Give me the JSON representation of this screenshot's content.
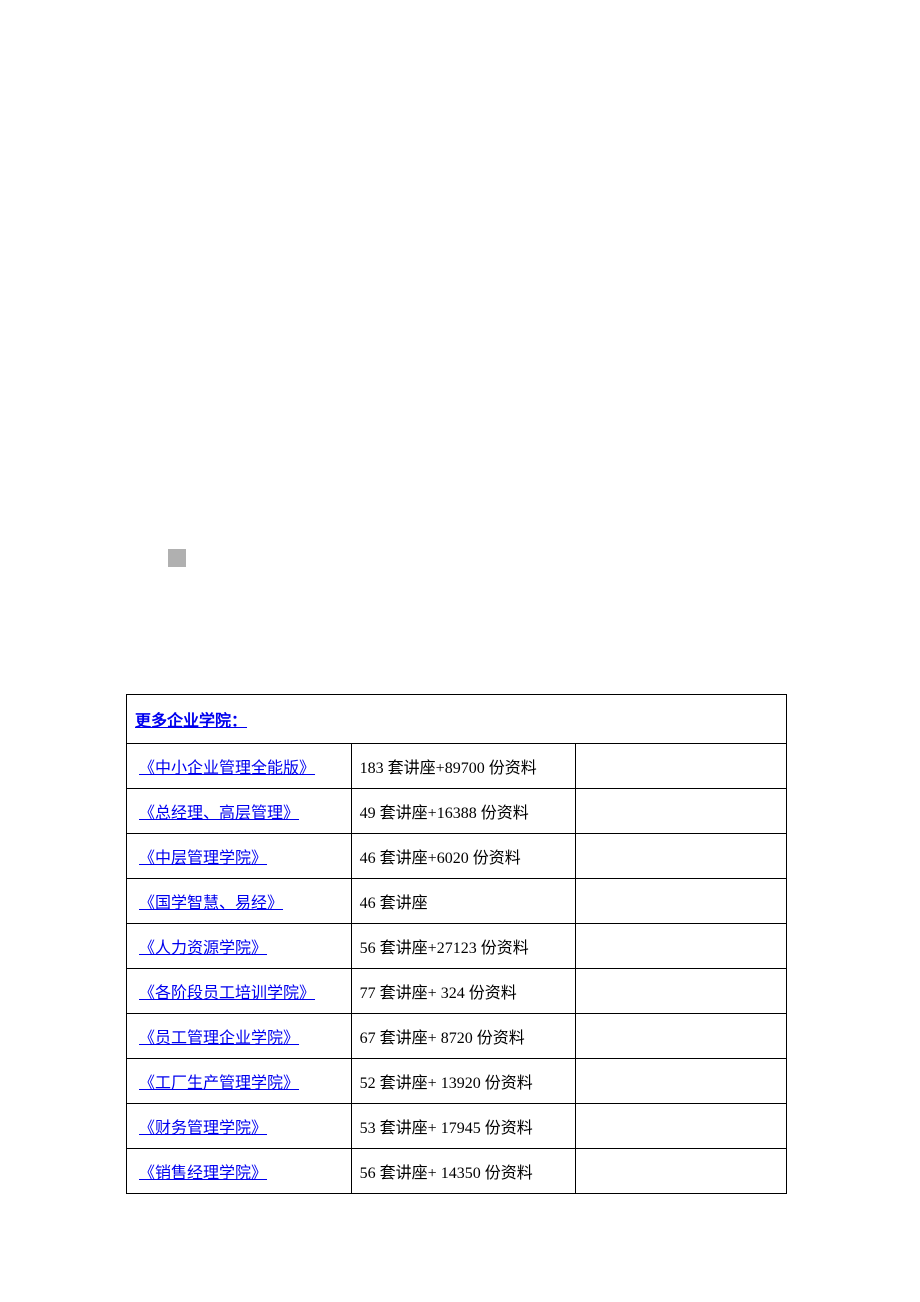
{
  "header": "更多企业学院：",
  "rows": [
    {
      "name": "《中小企业管理全能版》",
      "desc": "183 套讲座+89700 份资料"
    },
    {
      "name": "《总经理、高层管理》",
      "desc": "49 套讲座+16388 份资料"
    },
    {
      "name": "《中层管理学院》",
      "desc": "46 套讲座+6020 份资料"
    },
    {
      "name": "《国学智慧、易经》",
      "desc": "46 套讲座"
    },
    {
      "name": "《人力资源学院》",
      "desc": "56 套讲座+27123 份资料"
    },
    {
      "name": "《各阶段员工培训学院》",
      "desc": "77 套讲座+ 324 份资料"
    },
    {
      "name": "《员工管理企业学院》",
      "desc": "67 套讲座+ 8720 份资料"
    },
    {
      "name": "《工厂生产管理学院》",
      "desc": "52 套讲座+ 13920 份资料"
    },
    {
      "name": "《财务管理学院》",
      "desc": "53 套讲座+ 17945 份资料"
    },
    {
      "name": "《销售经理学院》",
      "desc": "56 套讲座+ 14350 份资料"
    }
  ]
}
